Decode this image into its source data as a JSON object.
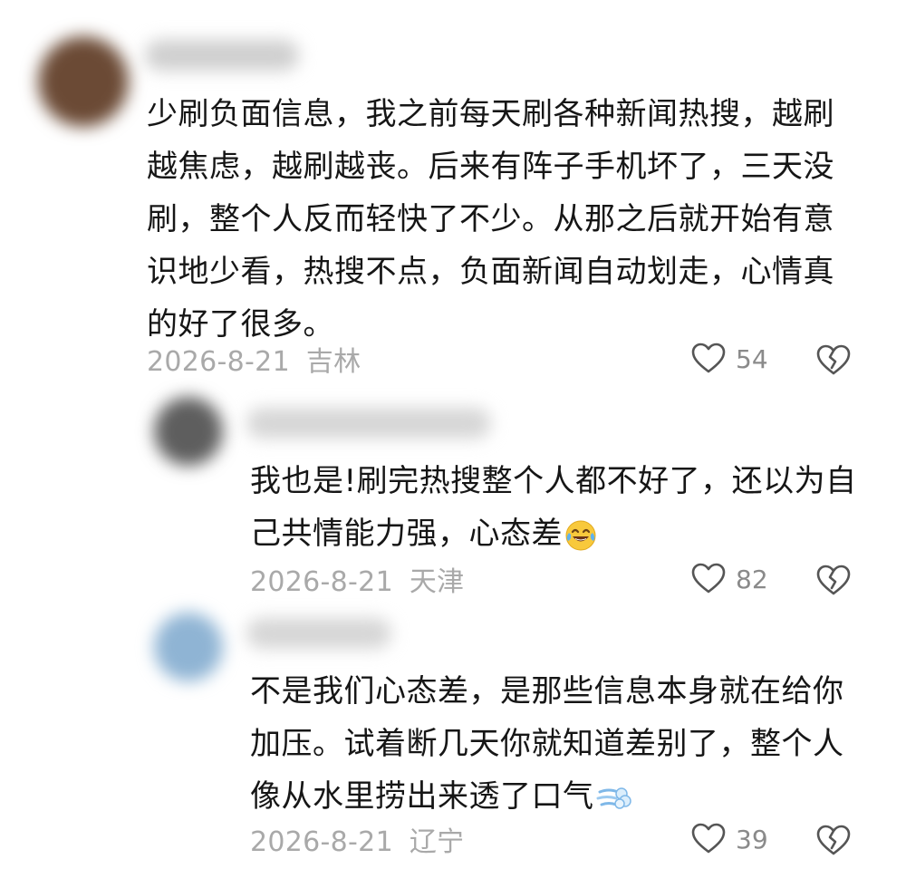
{
  "comments": [
    {
      "lines": [
        "少刷负面信息，我之前每天刷各种新闻热搜，越刷",
        "越焦虑，越刷越丧。后来有阵子手机坏了，三天没",
        "刷，整个人反而轻快了不少。从那之后就开始有意",
        "识地少看，热搜不点，负面新闻自动划走，心情真",
        "的好了很多。"
      ],
      "date": "2026-8-21",
      "location": "吉林",
      "likes": "54",
      "avatar_color": "#6b4a35"
    },
    {
      "lines": [
        "我也是!刷完热搜整个人都不好了，还以为自",
        "己共情能力强，心态差"
      ],
      "emoji": "face-with-tears-of-joy",
      "date": "2026-8-21",
      "location": "天津",
      "likes": "82",
      "avatar_color": "#5e5e5e"
    },
    {
      "lines": [
        "不是我们心态差，是那些信息本身就在给你",
        "加压。试着断几天你就知道差别了，整个人",
        "像从水里捞出来透了口气"
      ],
      "emoji": "dashing-away",
      "date": "2026-8-21",
      "location": "辽宁",
      "likes": "39",
      "avatar_color": "#8fb4d4"
    }
  ],
  "icons": {
    "like": "heart-outline-icon",
    "dislike": "broken-heart-icon"
  }
}
